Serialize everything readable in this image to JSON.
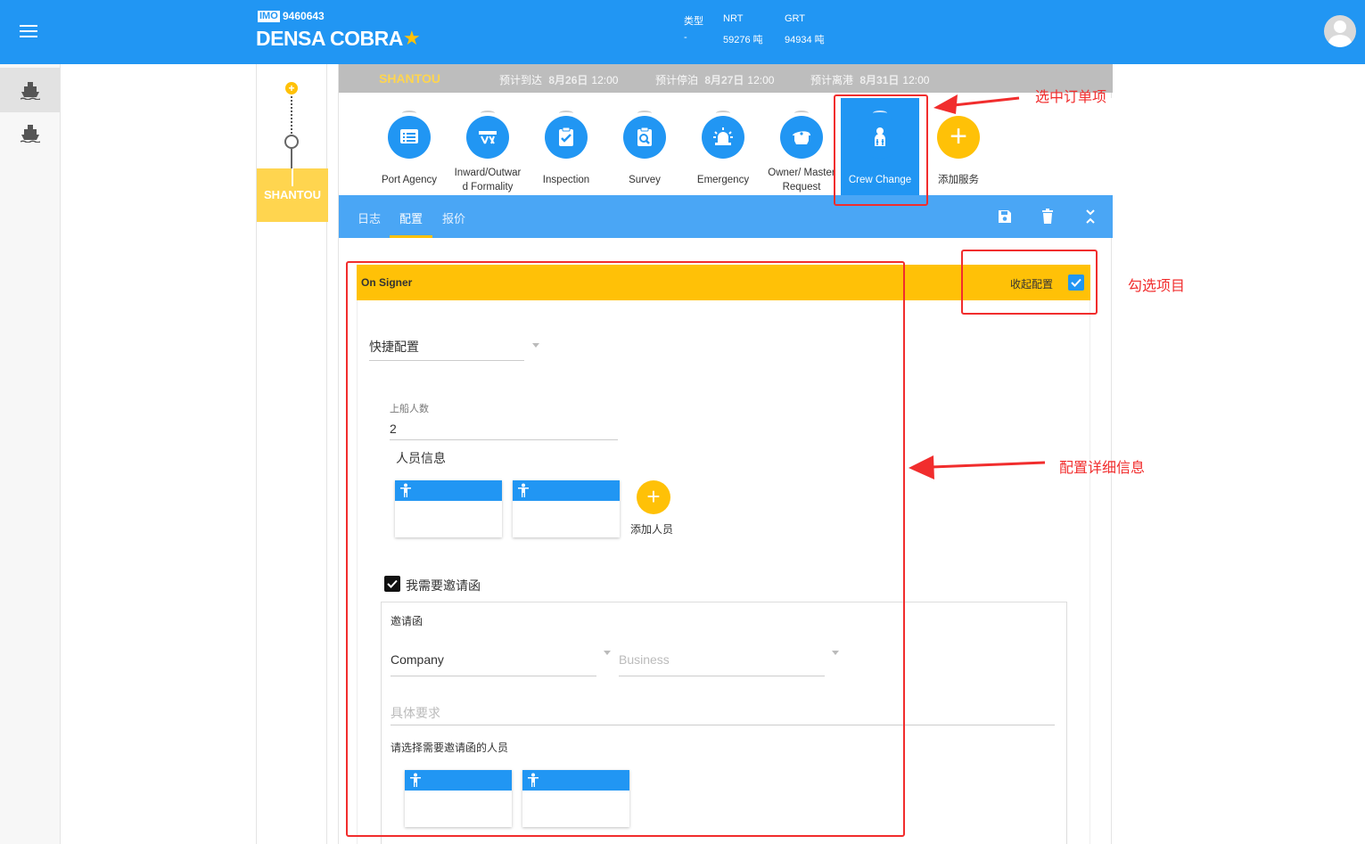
{
  "header": {
    "imo_tag": "IMO",
    "imo_number": "9460643",
    "ship_name": "DENSA COBRA",
    "stats": [
      {
        "label": "类型",
        "value": "-"
      },
      {
        "label": "NRT",
        "value": "59276 吨"
      },
      {
        "label": "GRT",
        "value": "94934 吨"
      }
    ]
  },
  "timeline": {
    "port": "SHANTOU"
  },
  "portbar": {
    "port": "SHANTOU",
    "eta": {
      "label": "预计到达",
      "date": "8月26日",
      "time": "12:00"
    },
    "etb": {
      "label": "预计停泊",
      "date": "8月27日",
      "time": "12:00"
    },
    "etd": {
      "label": "预计离港",
      "date": "8月31日",
      "time": "12:00"
    }
  },
  "services": [
    {
      "label": "Port Agency",
      "icon": "list-icon"
    },
    {
      "label": "Inward/Outwar\nd Formality",
      "icon": "gangway-icon"
    },
    {
      "label": "Inspection",
      "icon": "clipboard-check-icon"
    },
    {
      "label": "Survey",
      "icon": "clipboard-search-icon"
    },
    {
      "label": "Emergency",
      "icon": "siren-icon"
    },
    {
      "label": "Owner/ Master\nRequest",
      "icon": "captain-hat-icon"
    },
    {
      "label": "Crew Change",
      "icon": "crew-icon"
    },
    {
      "label": "添加服务",
      "icon": "plus-icon"
    }
  ],
  "tabs": [
    "日志",
    "配置",
    "报价"
  ],
  "signer": {
    "title": "On Signer",
    "collapse_label": "收起配置"
  },
  "form": {
    "quick_config": "快捷配置",
    "onboard_count_label": "上船人数",
    "onboard_count": "2",
    "crew_info_label": "人员信息",
    "add_person_label": "添加人员",
    "need_invitation_label": "我需要邀请函",
    "invitation_title": "邀请函",
    "invitation_type": "Company",
    "invitation_business_placeholder": "Business",
    "requirements_placeholder": "具体要求",
    "select_person_label": "请选择需要邀请函的人员"
  },
  "annotations": {
    "selected_order": "选中订单项",
    "check_item": "勾选项目",
    "config_details": "配置详细信息"
  },
  "colors": {
    "primary": "#2196f3",
    "accent": "#ffc107",
    "annotation": "#f12d2d"
  }
}
